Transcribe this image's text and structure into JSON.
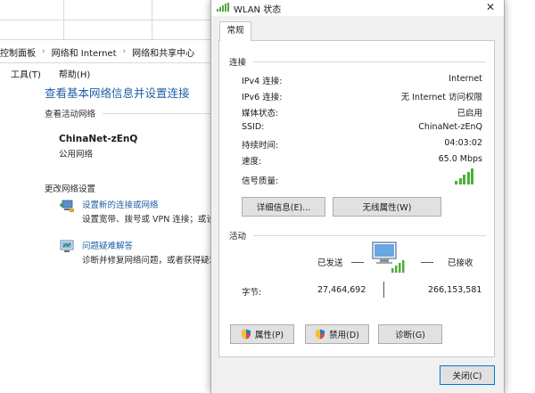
{
  "background": {
    "breadcrumb": [
      "控制面板",
      "网络和 Internet",
      "网络和共享中心"
    ],
    "menu": [
      "工具(T)",
      "帮助(H)"
    ],
    "heading": "查看基本网络信息并设置连接",
    "active_networks_label": "查看活动网络",
    "network_name": "ChinaNet-zEnQ",
    "network_type": "公用网络",
    "change_settings_label": "更改网络设置",
    "tasks": [
      {
        "link": "设置新的连接或网络",
        "desc": "设置宽带、拨号或 VPN 连接；或设"
      },
      {
        "link": "问题疑难解答",
        "desc": "诊断并修复网络问题，或者获得疑难"
      }
    ]
  },
  "dialog": {
    "title": "WLAN 状态",
    "close_glyph": "✕",
    "tab": "常规",
    "connection": {
      "group_label": "连接",
      "rows": [
        {
          "label": "IPv4 连接:",
          "value": "Internet"
        },
        {
          "label": "IPv6 连接:",
          "value": "无 Internet 访问权限"
        },
        {
          "label": "媒体状态:",
          "value": "已启用"
        },
        {
          "label": "SSID:",
          "value": "ChinaNet-zEnQ"
        },
        {
          "label": "持续时间:",
          "value": "04:03:02"
        },
        {
          "label": "速度:",
          "value": "65.0 Mbps"
        }
      ],
      "signal_label": "信号质量:",
      "signal_bars_filled": 5,
      "signal_bars_total": 5,
      "details_button": "详细信息(E)...",
      "wireless_props_button": "无线属性(W)"
    },
    "activity": {
      "group_label": "活动",
      "sent_label": "已发送",
      "received_label": "已接收",
      "bytes_label": "字节:",
      "bytes_sent": "27,464,692",
      "bytes_received": "266,153,581"
    },
    "buttons": {
      "properties": "属性(P)",
      "disable": "禁用(D)",
      "diagnose": "诊断(G)",
      "close": "关闭(C)"
    },
    "colors": {
      "accent": "#0078d7",
      "signal": "#4cae3a",
      "link": "#1f5fa6"
    }
  }
}
